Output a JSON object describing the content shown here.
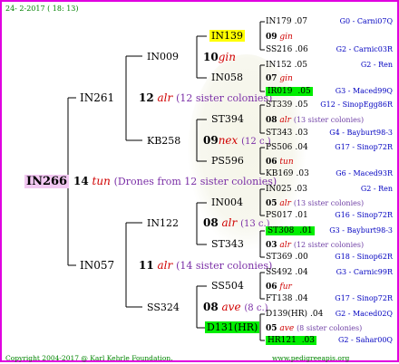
{
  "header": {
    "date_time": "24-  2-2017 ( 18: 13)"
  },
  "footer": {
    "left": "Copyright 2004-2017 @ Karl Kehrle Foundation.",
    "right": "www.pedigreeapis.org"
  },
  "root": {
    "id": "IN266",
    "num": "14",
    "breed": "tun",
    "note": "(Drones from 12 sister colonies)"
  },
  "gen1": [
    {
      "id": "IN261",
      "num": "12",
      "breed": "alr",
      "note": "(12 sister colonies)"
    },
    {
      "id": "IN057",
      "num": "11",
      "breed": "alr",
      "note": "(14 sister colonies)"
    }
  ],
  "gen2": [
    {
      "id": "IN009",
      "num": "10",
      "breed": "gin",
      "note": ""
    },
    {
      "id": "KB258",
      "num": "09",
      "breed": "nex",
      "note": "(12 c.)"
    },
    {
      "id": "IN122",
      "num": "08",
      "breed": "alr",
      "note": "(13 c.)"
    },
    {
      "id": "SS324",
      "num": "08",
      "breed": "ave",
      "note": "(8 c.)"
    }
  ],
  "gen3": [
    {
      "id": "IN139",
      "num": "09",
      "breed": "gin",
      "note": ""
    },
    {
      "id": "IN058",
      "num": "07",
      "breed": "gin",
      "note": ""
    },
    {
      "id": "ST394",
      "num": "08",
      "breed": "alr",
      "note": "(13 sister colonies)"
    },
    {
      "id": "PS596",
      "num": "06",
      "breed": "tun",
      "note": ""
    },
    {
      "id": "IN004",
      "num": "05",
      "breed": "alr",
      "note": "(13 sister colonies)"
    },
    {
      "id": "ST343",
      "num": "03",
      "breed": "alr",
      "note": "(12 sister colonies)"
    },
    {
      "id": "SS504",
      "num": "06",
      "breed": "fur",
      "note": ""
    },
    {
      "id": "D131(HR)",
      "num": "05",
      "breed": "ave",
      "note": "(8 sister colonies)"
    }
  ],
  "gen4": [
    {
      "id": "IN179",
      "yr": ".07",
      "src": "G0 - Carni07Q"
    },
    {
      "id": "SS216",
      "yr": ".06",
      "src": "G2 - Carnic03R"
    },
    {
      "id": "IN152",
      "yr": ".05",
      "src": "G2 - Ren"
    },
    {
      "id": "IR019",
      "yr": ".05",
      "src": "G3 - Maced99Q"
    },
    {
      "id": "ST339",
      "yr": ".05",
      "src": "G12 - SinopEgg86R"
    },
    {
      "id": "ST343",
      "yr": ".03",
      "src": "G4 - Bayburt98-3"
    },
    {
      "id": "PS506",
      "yr": ".04",
      "src": "G17 - Sinop72R"
    },
    {
      "id": "KB169",
      "yr": ".03",
      "src": "G6 - Maced93R"
    },
    {
      "id": "IN025",
      "yr": ".03",
      "src": "G2 - Ren"
    },
    {
      "id": "PS017",
      "yr": ".01",
      "src": "G16 - Sinop72R"
    },
    {
      "id": "ST308",
      "yr": ".01",
      "src": "G3 - Bayburt98-3"
    },
    {
      "id": "ST369",
      "yr": ".00",
      "src": "G18 - Sinop62R"
    },
    {
      "id": "SS492",
      "yr": ".04",
      "src": "G3 - Carnic99R"
    },
    {
      "id": "FT138",
      "yr": ".04",
      "src": "G17 - Sinop72R"
    },
    {
      "id": "D139(HR)",
      "yr": ".04",
      "src": "G2 - Maced02Q"
    },
    {
      "id": "HR121",
      "yr": ".03",
      "src": "G2 - Sahar00Q"
    }
  ]
}
